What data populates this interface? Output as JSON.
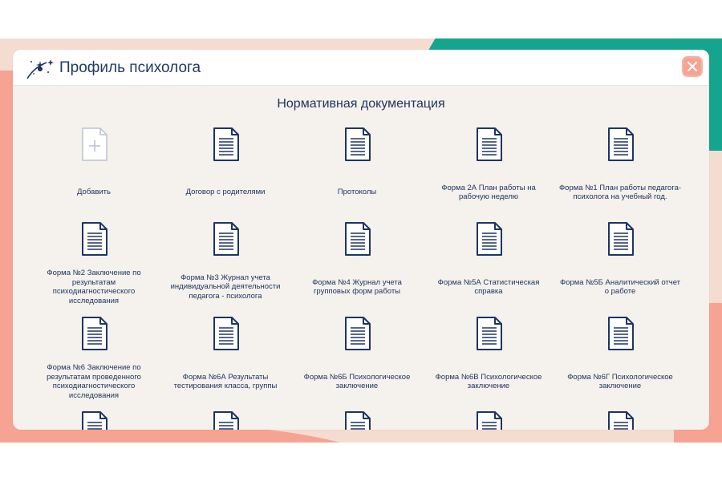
{
  "app": {
    "title": "Профиль психолога"
  },
  "section": {
    "title": "Нормативная документация"
  },
  "items": [
    {
      "label": "Добавить",
      "icon": "add-document-icon"
    },
    {
      "label": "Договор с родителями",
      "icon": "document-icon"
    },
    {
      "label": "Протоколы",
      "icon": "document-icon"
    },
    {
      "label": "Форма 2А План работы на рабочую неделю",
      "icon": "document-icon"
    },
    {
      "label": "Форма №1 План работы педагога- психолога на учебный год.",
      "icon": "document-icon"
    },
    {
      "label": "Форма №2 Заключение по результатам психодиагностического исследования",
      "icon": "document-icon"
    },
    {
      "label": "Форма №3 Журнал учета индивидуальной деятельности педагога - психолога",
      "icon": "document-icon"
    },
    {
      "label": "Форма №4 Журнал учета групповых форм работы",
      "icon": "document-icon"
    },
    {
      "label": "Форма №5А Статистическая справка",
      "icon": "document-icon"
    },
    {
      "label": "Форма №5Б Аналитический отчет о работе",
      "icon": "document-icon"
    },
    {
      "label": "Форма №6 Заключение по результатам проведенного психодиагностического исследования",
      "icon": "document-icon"
    },
    {
      "label": "Форма №6А Результаты тестирования класса, группы",
      "icon": "document-icon"
    },
    {
      "label": "Форма №6Б Психологическое заключение",
      "icon": "document-icon"
    },
    {
      "label": "Форма №6В Психологическое заключение",
      "icon": "document-icon"
    },
    {
      "label": "Форма №6Г Психологическое заключение",
      "icon": "document-icon"
    },
    {
      "label": "",
      "icon": "document-icon"
    },
    {
      "label": "",
      "icon": "document-icon"
    },
    {
      "label": "",
      "icon": "document-icon"
    },
    {
      "label": "",
      "icon": "document-icon"
    },
    {
      "label": "",
      "icon": "document-icon"
    }
  ],
  "colors": {
    "accent_text": "#1e3563",
    "teal": "#15a58f",
    "coral": "#f7a393",
    "peach": "#f5dcd0",
    "panel": "#f5f1ec",
    "add_icon": "#b9c2d3"
  }
}
